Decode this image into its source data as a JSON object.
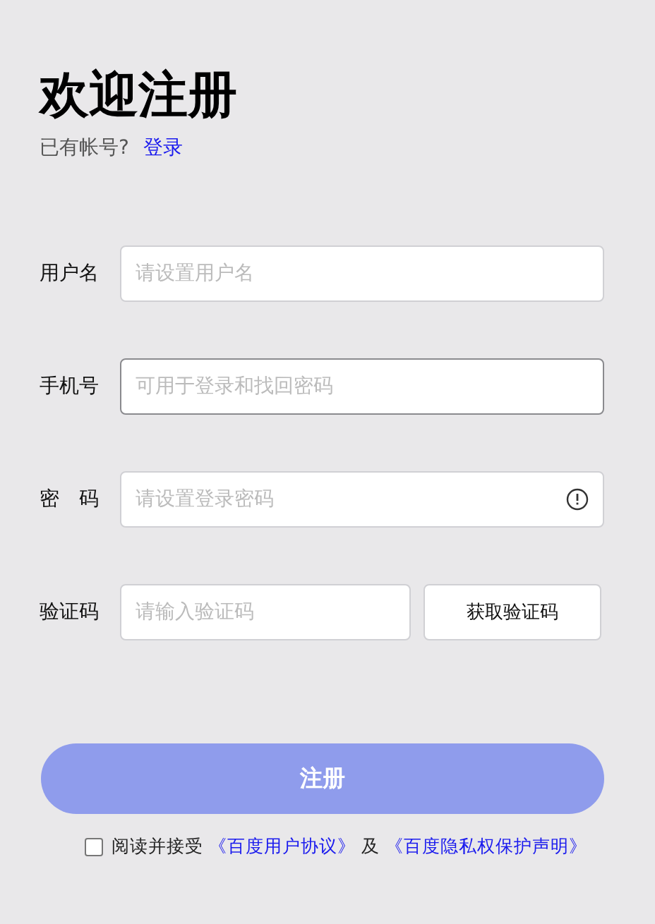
{
  "title": "欢迎注册",
  "login_prompt": {
    "text": "已有帐号?",
    "link": "登录"
  },
  "fields": [
    {
      "kind": "text",
      "label": "用户名",
      "placeholder": "请设置用户名",
      "focused": false
    },
    {
      "kind": "text",
      "label": "手机号",
      "placeholder": "可用于登录和找回密码",
      "focused": true
    },
    {
      "kind": "password",
      "label": "密　码",
      "placeholder": "请设置登录密码",
      "focused": false
    },
    {
      "kind": "code",
      "label": "验证码",
      "placeholder": "请输入验证码",
      "focused": false,
      "button": "获取验证码"
    }
  ],
  "submit": {
    "label": "注册",
    "disabled": true
  },
  "agreement": {
    "checked": false,
    "text": "阅读并接受",
    "link_1": "《百度用户协议》",
    "conjunction": "及",
    "link_2": "《百度隐私权保护声明》"
  }
}
